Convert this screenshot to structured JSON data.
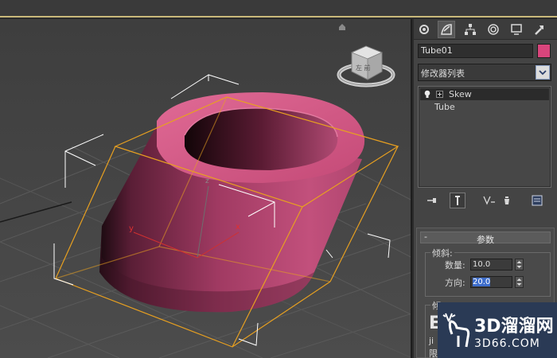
{
  "object": {
    "name": "Tube01",
    "color": "#d9457c"
  },
  "modifier_list": {
    "label": "修改器列表"
  },
  "modifier_stack": [
    {
      "label": "Skew",
      "selected": true
    },
    {
      "label": "Tube",
      "selected": false
    }
  ],
  "rollout": {
    "toggle": "-",
    "title": "参数"
  },
  "skew_group": {
    "label": "倾斜:",
    "amount_label": "数量:",
    "amount_value": "10.0",
    "direction_label": "方向:",
    "direction_value": "20.0"
  },
  "next_group": {
    "label_fragment": "倾",
    "letter": "E",
    "sub1": "ji",
    "sub2": "限"
  },
  "tabs": [
    {
      "icon": "create-icon",
      "active": false
    },
    {
      "icon": "modify-icon",
      "active": true
    },
    {
      "icon": "hierarchy-icon",
      "active": false
    },
    {
      "icon": "motion-icon",
      "active": false
    },
    {
      "icon": "display-icon",
      "active": false
    },
    {
      "icon": "utilities-icon",
      "active": false
    }
  ],
  "stack_tools": [
    {
      "icon": "pin-stack-icon"
    },
    {
      "icon": "show-end-result-icon"
    },
    {
      "icon": "make-unique-icon"
    },
    {
      "icon": "remove-modifier-icon"
    },
    {
      "icon": "configure-modifier-sets-icon"
    }
  ],
  "viewport": {
    "axis_x": "x",
    "axis_y": "y",
    "axis_z": "z",
    "viewcube_text": "左 前"
  },
  "watermark": {
    "text": "3D溜溜网",
    "url": "3D66.COM"
  },
  "colors": {
    "tube": "#d9457c",
    "gizmo": "#e8a020",
    "selection_bracket": "#ffffff",
    "panel_bg": "#444444"
  }
}
